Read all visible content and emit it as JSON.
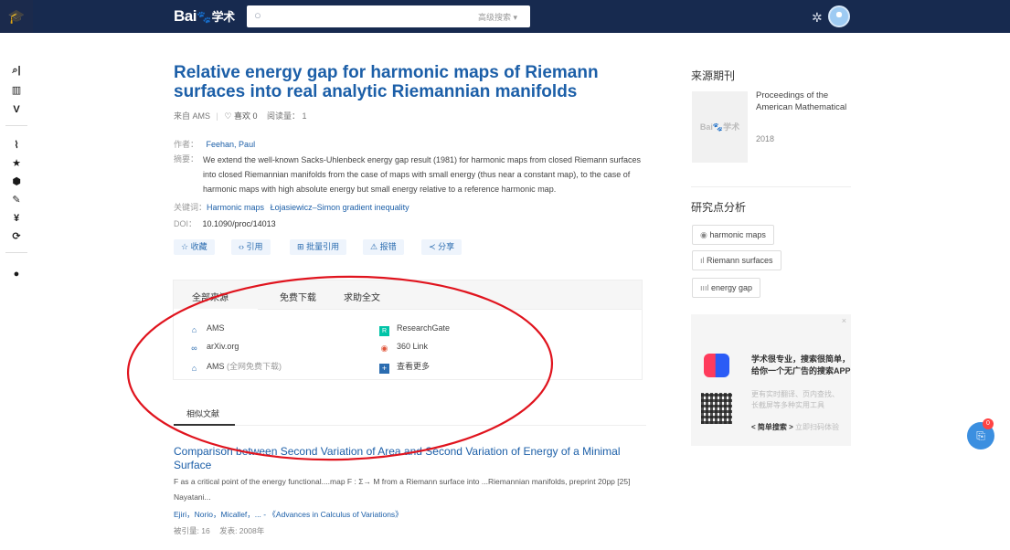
{
  "header": {
    "logo_text": "Bai",
    "logo_paw": "🐾",
    "logo_suffix": "学术",
    "search_placeholder": "",
    "advanced_search": "高级搜索 ▾"
  },
  "paper": {
    "title": "Relative energy gap for harmonic maps of Riemann surfaces into real analytic Riemannian manifolds",
    "source_label": "来自 AMS",
    "like_label": "♡ 喜欢 0",
    "read_label": "阅读量： 1",
    "author_label": "作者：",
    "author": "Feehan, Paul",
    "abstract_label": "摘要：",
    "abstract": "We extend the well-known Sacks-Uhlenbeck energy gap result (1981) for harmonic maps from closed Riemann surfaces into closed Riemannian manifolds from the case of maps with small energy (thus near a constant map), to the case of harmonic maps with high absolute energy but small energy relative to a reference harmonic map.",
    "keywords_label": "关键词：",
    "keywords": [
      "Harmonic maps",
      "Łojasiewicz–Simon gradient inequality"
    ],
    "doi_label": "DOI：",
    "doi": "10.1090/proc/14013"
  },
  "actions": [
    {
      "icon": "☆",
      "label": "收藏"
    },
    {
      "icon": "‹›",
      "label": "引用"
    },
    {
      "icon": "⊞",
      "label": "批量引用"
    },
    {
      "icon": "⚠",
      "label": "报错"
    },
    {
      "icon": "≺",
      "label": "分享"
    }
  ],
  "sources": {
    "tabs": [
      "全部来源",
      "免费下载",
      "求助全文"
    ],
    "left": [
      {
        "icon": "institution-icon",
        "label": "AMS",
        "note": ""
      },
      {
        "icon": "link-icon",
        "label": "arXiv.org",
        "note": ""
      },
      {
        "icon": "institution-icon",
        "label": "AMS",
        "note": "(全网免费下载)"
      }
    ],
    "right": [
      {
        "icon": "researchgate-icon",
        "label": "ResearchGate"
      },
      {
        "icon": "360-icon",
        "label": "360 Link"
      },
      {
        "icon": "plus-icon",
        "label": "查看更多"
      }
    ]
  },
  "related": {
    "tab_label": "相似文献",
    "title": "Comparison between Second Variation of Area and Second Variation of Energy of a Minimal Surface",
    "snippet": "F as a critical point of the energy functional....map F : Σ→ M from a Riemann surface into ...Riemannian manifolds, preprint 20pp [25] Nayatani...",
    "authors": "Ejiri，Norio，Micallef，... - 《Advances in Calculus of Variations》",
    "cited_label": "被引量: 16",
    "published_label": "发表: 2008年"
  },
  "right_panel": {
    "journal_heading": "来源期刊",
    "journal_name": "Proceedings of the American Mathematical",
    "journal_year": "2018",
    "cover_text": "Bai🐾学术",
    "analysis_heading": "研究点分析",
    "tags": [
      {
        "icon": "◉",
        "label": "harmonic maps"
      },
      {
        "icon": "ıl",
        "label": "Riemann surfaces"
      },
      {
        "icon": "ıııl",
        "label": "energy gap"
      }
    ],
    "ad": {
      "close": "×",
      "line1": "学术很专业，搜索很简单，",
      "line2": "给你一个无广告的搜索APP",
      "desc1": "更有实时翻译、页内查找、",
      "desc2": "长截屏等多种实用工具",
      "cta": "< 简单搜索 >",
      "cta_hint": "立即扫码体验"
    }
  },
  "float_badge": "0",
  "colors": {
    "header": "#172a4f",
    "link": "#1c5fa8",
    "annotation": "#e0141e"
  }
}
